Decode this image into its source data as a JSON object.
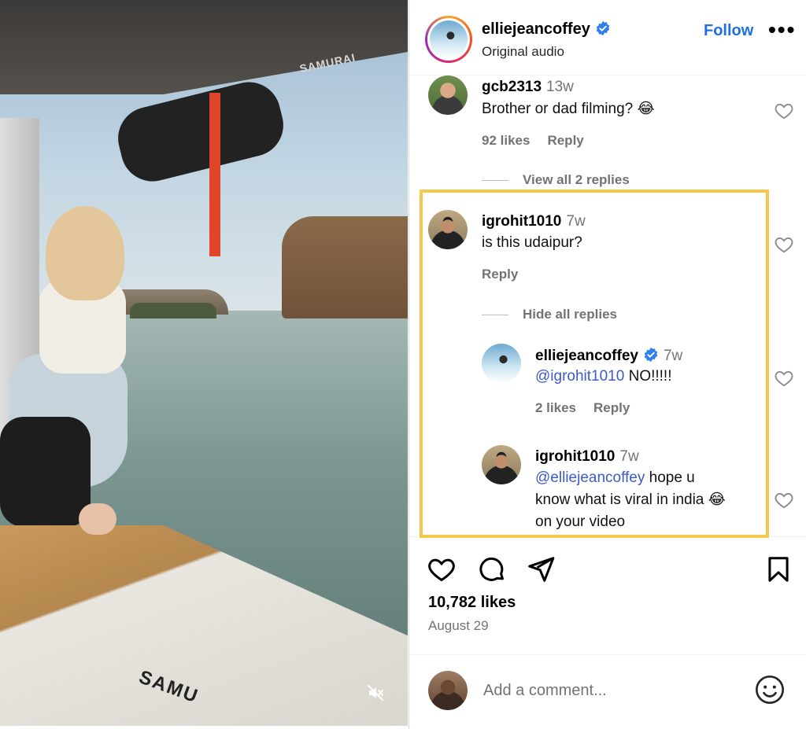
{
  "post": {
    "username": "elliejeancoffey",
    "audio": "Original audio",
    "follow_label": "Follow",
    "more_label": "•••",
    "likes": "10,782 likes",
    "date": "August 29",
    "media_brand_top": "SAMURAI",
    "media_brand_bottom": "SAMU"
  },
  "comments": [
    {
      "username": "gcb2313",
      "time": "13w",
      "text": "Brother or dad filming? 😂",
      "likes": "92 likes",
      "reply": "Reply",
      "replies_toggle": "View all 2 replies"
    },
    {
      "username": "igrohit1010",
      "time": "7w",
      "text": "is this udaipur?",
      "reply": "Reply",
      "replies_toggle": "Hide all replies",
      "replies": [
        {
          "username": "elliejeancoffey",
          "time": "7w",
          "mention": "@igrohit1010",
          "text": " NO!!!!!",
          "likes": "2 likes",
          "reply": "Reply"
        },
        {
          "username": "igrohit1010",
          "time": "7w",
          "mention": "@elliejeancoffey",
          "text_line1": " hope u",
          "text_line2": "know what is viral in india 😂",
          "text_line3": "on your video"
        }
      ]
    }
  ],
  "add_comment": {
    "placeholder": "Add a comment..."
  },
  "colors": {
    "link_blue": "#1f6fe6",
    "mention_blue": "#3d5ac9",
    "highlight": "#f2c94c",
    "muted_text": "#737373"
  },
  "icons": [
    "verified-badge-icon",
    "heart-icon",
    "comment-icon",
    "share-icon",
    "bookmark-icon",
    "emoji-icon",
    "mute-icon"
  ]
}
